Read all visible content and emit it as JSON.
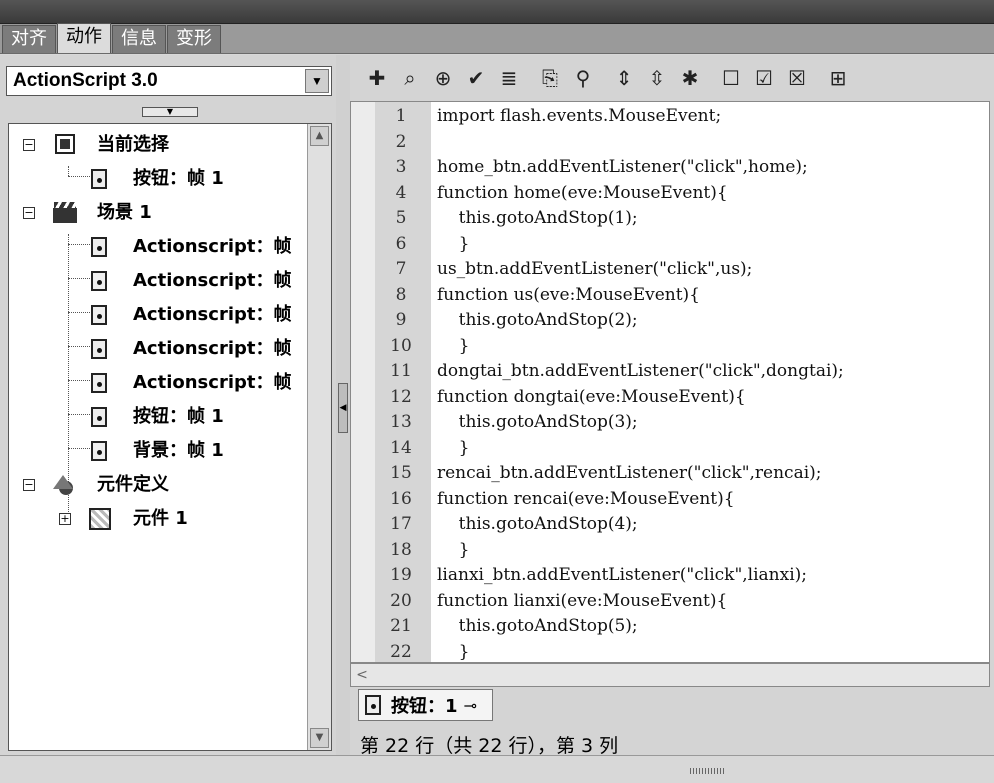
{
  "panel_tabs": [
    {
      "label": "对齐",
      "active": false
    },
    {
      "label": "动作",
      "active": true
    },
    {
      "label": "信息",
      "active": false
    },
    {
      "label": "变形",
      "active": false
    }
  ],
  "language_select": {
    "value": "ActionScript 3.0"
  },
  "tree": {
    "current_selection": {
      "label": "当前选择",
      "children": [
        {
          "label": "按钮：帧 1"
        }
      ]
    },
    "scene": {
      "label": "场景 1",
      "children": [
        {
          "label": "Actionscript：帧"
        },
        {
          "label": "Actionscript：帧"
        },
        {
          "label": "Actionscript：帧"
        },
        {
          "label": "Actionscript：帧"
        },
        {
          "label": "Actionscript：帧"
        },
        {
          "label": "按钮：帧 1"
        },
        {
          "label": "背景：帧 1"
        }
      ]
    },
    "symbols": {
      "label": "元件定义",
      "children": [
        {
          "label": "元件 1"
        }
      ]
    }
  },
  "toolbar_icons": [
    "add-statement-icon",
    "find-icon",
    "insert-target-path-icon",
    "check-syntax-icon",
    "auto-format-icon",
    "show-code-hint-icon",
    "debug-options-icon",
    "collapse-between-braces-icon",
    "collapse-selection-icon",
    "expand-all-icon",
    "apply-block-comment-icon",
    "apply-line-comment-icon",
    "remove-comment-icon",
    "show-hide-toolbox-icon"
  ],
  "code_lines": [
    "import flash.events.MouseEvent;",
    "",
    "home_btn.addEventListener(\"click\",home);",
    "function home(eve:MouseEvent){",
    "    this.gotoAndStop(1);",
    "    }",
    "us_btn.addEventListener(\"click\",us);",
    "function us(eve:MouseEvent){",
    "    this.gotoAndStop(2);",
    "    }",
    "dongtai_btn.addEventListener(\"click\",dongtai);",
    "function dongtai(eve:MouseEvent){",
    "    this.gotoAndStop(3);",
    "    }",
    "rencai_btn.addEventListener(\"click\",rencai);",
    "function rencai(eve:MouseEvent){",
    "    this.gotoAndStop(4);",
    "    }",
    "lianxi_btn.addEventListener(\"click\",lianxi);",
    "function lianxi(eve:MouseEvent){",
    "    this.gotoAndStop(5);",
    "    }"
  ],
  "file_tab": {
    "label": "按钮：1"
  },
  "status": {
    "text": "第 22 行（共 22 行），第 3 列"
  }
}
